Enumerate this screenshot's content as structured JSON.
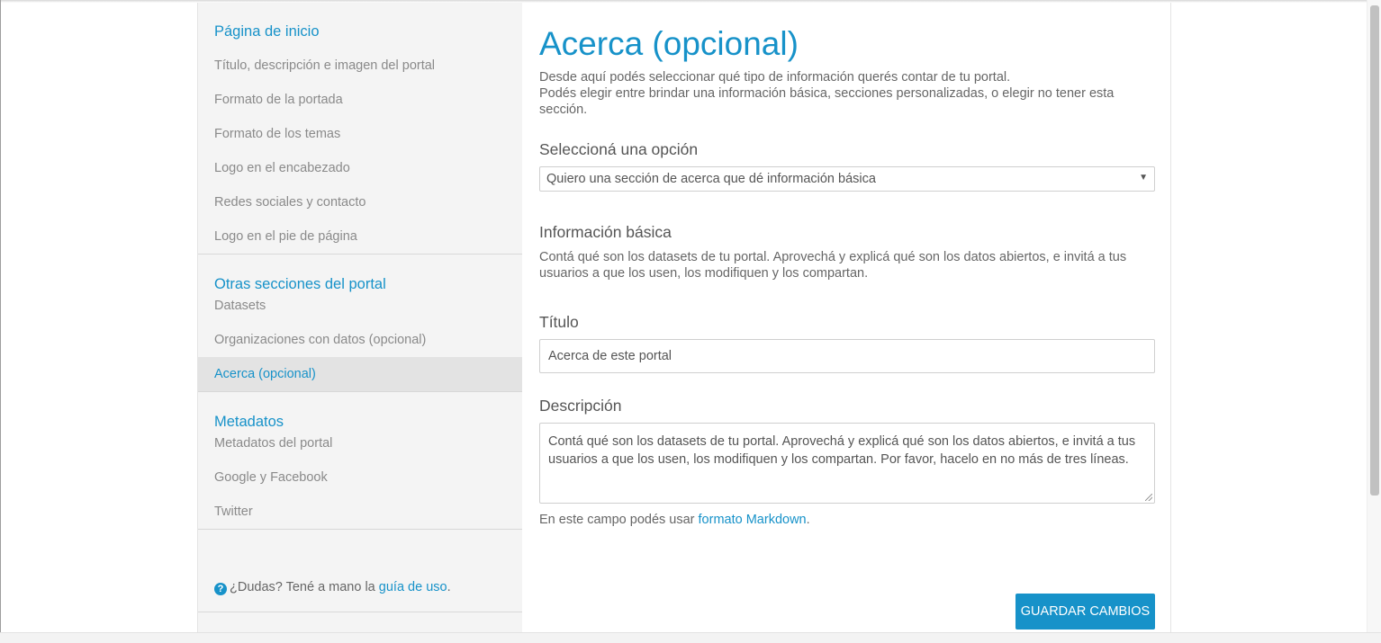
{
  "sidebar": {
    "sections": [
      {
        "title": "Página de inicio",
        "items": [
          {
            "label": "Título, descripción e imagen del portal"
          },
          {
            "label": "Formato de la portada"
          },
          {
            "label": "Formato de los temas"
          },
          {
            "label": "Logo en el encabezado"
          },
          {
            "label": "Redes sociales y contacto"
          },
          {
            "label": "Logo en el pie de página"
          }
        ]
      },
      {
        "title": "Otras secciones del portal",
        "items": [
          {
            "label": "Datasets"
          },
          {
            "label": "Organizaciones con datos (opcional)"
          },
          {
            "label": "Acerca (opcional)",
            "active": true
          }
        ]
      },
      {
        "title": "Metadatos",
        "items": [
          {
            "label": "Metadatos del portal"
          },
          {
            "label": "Google y Facebook"
          },
          {
            "label": "Twitter"
          }
        ]
      }
    ],
    "help": {
      "prefix": "¿Dudas? Tené a mano la",
      "link": "guía de uso",
      "suffix": "."
    }
  },
  "main": {
    "title": "Acerca (opcional)",
    "intro_line1": "Desde aquí podés seleccionar qué tipo de información querés contar de tu portal.",
    "intro_line2": "Podés elegir entre brindar una información básica, secciones personalizadas, o elegir no tener esta sección.",
    "select_label": "Seleccioná una opción",
    "select_value": "Quiero una sección de acerca que dé información básica",
    "basic_heading": "Información básica",
    "basic_help": "Contá qué son los datasets de tu portal. Aprovechá y explicá qué son los datos abiertos, e invitá a tus usuarios a que los usen, los modifiquen y los compartan.",
    "title_label": "Título",
    "title_value": "Acerca de este portal",
    "description_label": "Descripción",
    "description_value": "Contá qué son los datasets de tu portal. Aprovechá y explicá qué son los datos abiertos, e invitá a tus usuarios a que los usen, los modifiquen y los compartan. Por favor, hacelo en no más de tres líneas.",
    "markdown_prefix": "En este campo podés usar",
    "markdown_link": "formato Markdown",
    "markdown_suffix": ".",
    "save_label": "GUARDAR CAMBIOS"
  },
  "colors": {
    "accent": "#1792c9",
    "sidebar_bg": "#f4f4f4",
    "active_item_bg": "#e3e3e3"
  },
  "icons": {
    "help": "question-circle-icon",
    "select_arrow": "caret-down-icon"
  }
}
